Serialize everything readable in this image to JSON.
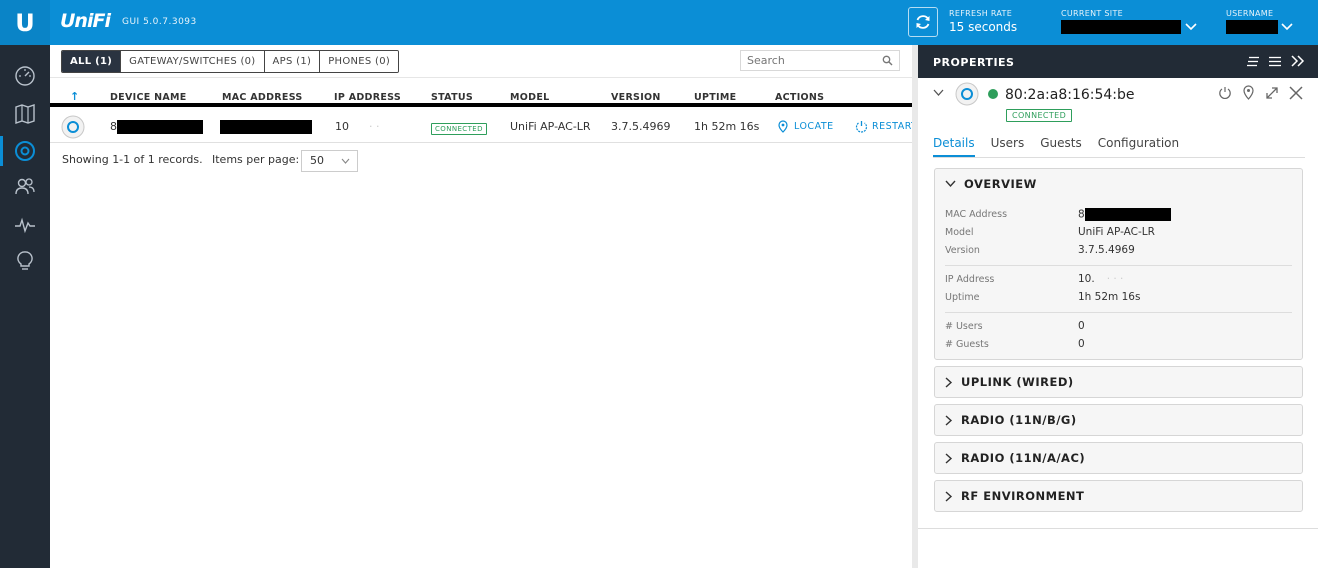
{
  "topbar": {
    "logo_letter": "U",
    "brand": "UniFi",
    "gui_version": "GUI 5.0.7.3093",
    "refresh_rate_label": "REFRESH RATE",
    "refresh_rate_value": "15 seconds",
    "current_site_label": "CURRENT SITE",
    "username_label": "USERNAME",
    "accent_color": "#0b8ed6"
  },
  "sidebar": {
    "items": [
      {
        "name": "dashboard",
        "icon": "speedometer-icon"
      },
      {
        "name": "map",
        "icon": "map-icon"
      },
      {
        "name": "devices",
        "icon": "device-icon",
        "active": true
      },
      {
        "name": "clients",
        "icon": "users-icon"
      },
      {
        "name": "statistics",
        "icon": "pulse-icon"
      },
      {
        "name": "insights",
        "icon": "lightbulb-icon"
      }
    ]
  },
  "filters": [
    {
      "label": "ALL (1)",
      "active": true
    },
    {
      "label": "GATEWAY/SWITCHES (0)"
    },
    {
      "label": "APS (1)"
    },
    {
      "label": "PHONES (0)"
    }
  ],
  "search": {
    "placeholder": "Search"
  },
  "table": {
    "sort_arrow": "↑",
    "columns": [
      "DEVICE NAME",
      "MAC ADDRESS",
      "IP ADDRESS",
      "STATUS",
      "MODEL",
      "VERSION",
      "UPTIME",
      "ACTIONS"
    ],
    "rows": [
      {
        "device_name_prefix": "8",
        "ip_prefix": "10",
        "status": "CONNECTED",
        "model": "UniFi AP-AC-LR",
        "version": "3.7.5.4969",
        "uptime": "1h 52m 16s",
        "action_locate": "LOCATE",
        "action_restart": "RESTART"
      }
    ]
  },
  "footer": {
    "showing": "Showing 1-1 of 1 records.",
    "items_per_page_label": "Items per page:",
    "items_per_page_value": "50"
  },
  "properties": {
    "title": "PROPERTIES",
    "device_mac": "80:2a:a8:16:54:be",
    "status": "CONNECTED",
    "status_color": "#2e9e5b",
    "tabs": [
      "Details",
      "Users",
      "Guests",
      "Configuration"
    ],
    "overview": {
      "title": "OVERVIEW",
      "mac_label": "MAC Address",
      "mac_prefix": "8",
      "model_label": "Model",
      "model_value": "UniFi AP-AC-LR",
      "version_label": "Version",
      "version_value": "3.7.5.4969",
      "ip_label": "IP Address",
      "ip_prefix": "10.",
      "uptime_label": "Uptime",
      "uptime_value": "1h 52m 16s",
      "users_label": "# Users",
      "users_value": "0",
      "guests_label": "# Guests",
      "guests_value": "0"
    },
    "sections": [
      "UPLINK (WIRED)",
      "RADIO (11N/B/G)",
      "RADIO (11N/A/AC)",
      "RF ENVIRONMENT"
    ]
  }
}
